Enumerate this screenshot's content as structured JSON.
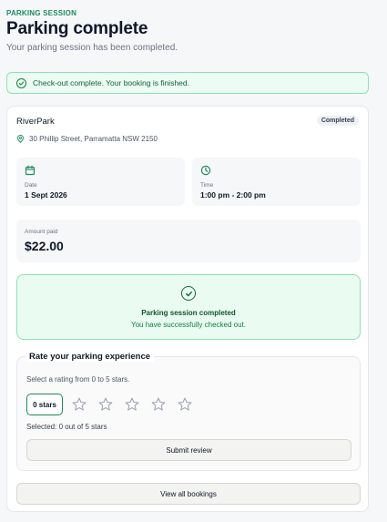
{
  "header": {
    "eyebrow": "PARKING SESSION",
    "title": "Parking complete",
    "subtitle": "Your parking session has been completed."
  },
  "banner": {
    "text": "Check-out complete. Your booking is finished.",
    "icon": "check-circle-icon"
  },
  "booking": {
    "venue": "RiverPark",
    "status": "Completed",
    "address": "30 Phillip Street, Parramatta NSW 2150",
    "date_label": "Date",
    "date_value": "1 Sept 2026",
    "time_label": "Time",
    "time_value": "1:00 pm - 2:00 pm",
    "amount_label": "Amount paid",
    "amount_value": "$22.00"
  },
  "success": {
    "title": "Parking session completed",
    "subtitle": "You have successfully checked out."
  },
  "rating": {
    "legend": "Rate your parking experience",
    "hint": "Select a rating from 0 to 5 stars.",
    "chip_label": "0 stars",
    "selected_text": "Selected: 0 out of 5 stars",
    "current": 0,
    "max": 5,
    "submit_label": "Submit review"
  },
  "footer": {
    "view_all_label": "View all bookings"
  },
  "colors": {
    "accent": "#1f8a5b",
    "success_bg": "#eafbf2",
    "success_border": "#8fe0b6"
  }
}
